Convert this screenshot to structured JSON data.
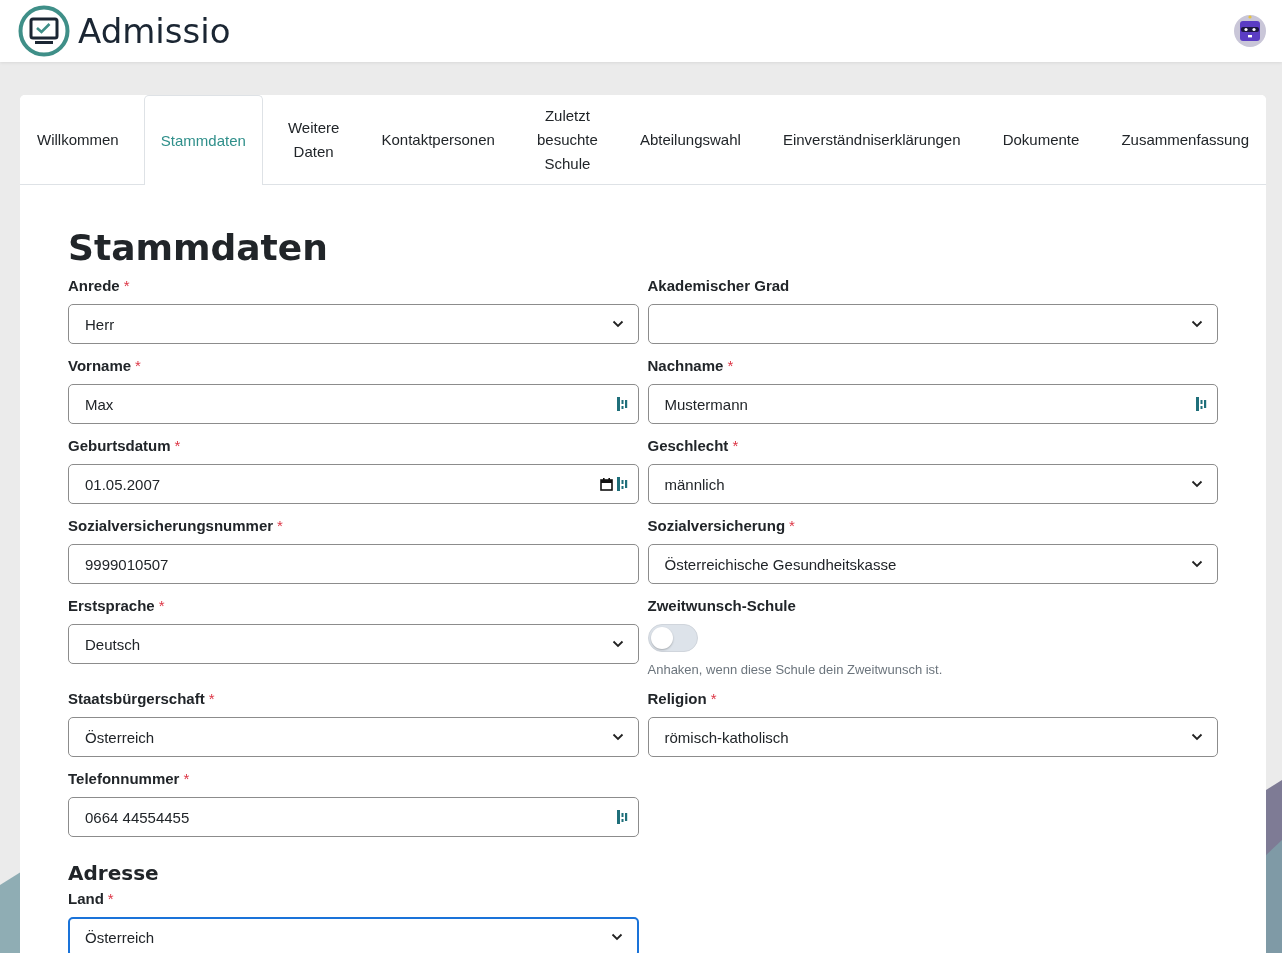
{
  "header": {
    "app_name": "Admissio"
  },
  "required_mark": "*",
  "tabs": [
    {
      "label": "Willkommen",
      "selected": false
    },
    {
      "label": "Stammdaten",
      "selected": true
    },
    {
      "label": "Weitere Daten",
      "selected": false
    },
    {
      "label": "Kontaktpersonen",
      "selected": false
    },
    {
      "label": "Zuletzt besuchte Schule",
      "selected": false
    },
    {
      "label": "Abteilungswahl",
      "selected": false
    },
    {
      "label": "Einverständniserklärungen",
      "selected": false
    },
    {
      "label": "Dokumente",
      "selected": false
    },
    {
      "label": "Zusammenfassung",
      "selected": false
    }
  ],
  "form": {
    "title": "Stammdaten",
    "fields": [
      {
        "kind": "select",
        "label": "Anrede",
        "required": true,
        "value": "Herr"
      },
      {
        "kind": "select",
        "label": "Akademischer Grad",
        "required": false
      },
      {
        "kind": "text",
        "label": "Vorname",
        "required": true,
        "value": "Max"
      },
      {
        "kind": "text",
        "label": "Nachname",
        "required": true,
        "value": "Mustermann"
      },
      {
        "kind": "date",
        "label": "Geburtsdatum",
        "required": true,
        "value": "01.05.2007"
      },
      {
        "kind": "select",
        "label": "Geschlecht",
        "required": true,
        "value": "männlich"
      },
      {
        "kind": "plain",
        "label": "Sozialversicherungsnummer",
        "required": true,
        "value": "9999010507"
      },
      {
        "kind": "select",
        "label": "Sozialversicherung",
        "required": true,
        "value": "Österreichische Gesundheitskasse"
      },
      {
        "kind": "select",
        "label": "Erstsprache",
        "required": true,
        "value": "Deutsch"
      },
      {
        "kind": "toggle",
        "label": "Zweitwunsch-Schule",
        "required": false,
        "on": false,
        "hint": "Anhaken, wenn diese Schule dein Zweitwunsch ist."
      },
      {
        "kind": "select",
        "label": "Staatsbürgerschaft",
        "required": true,
        "value": "Österreich"
      },
      {
        "kind": "select",
        "label": "Religion",
        "required": true,
        "value": "römisch-katholisch"
      },
      {
        "kind": "text",
        "label": "Telefonnummer",
        "required": true,
        "value": "0664 44554455"
      }
    ]
  },
  "address": {
    "title": "Adresse",
    "fields": [
      {
        "kind": "select",
        "label": "Land",
        "required": true,
        "value": "Österreich",
        "focused": true
      }
    ]
  }
}
